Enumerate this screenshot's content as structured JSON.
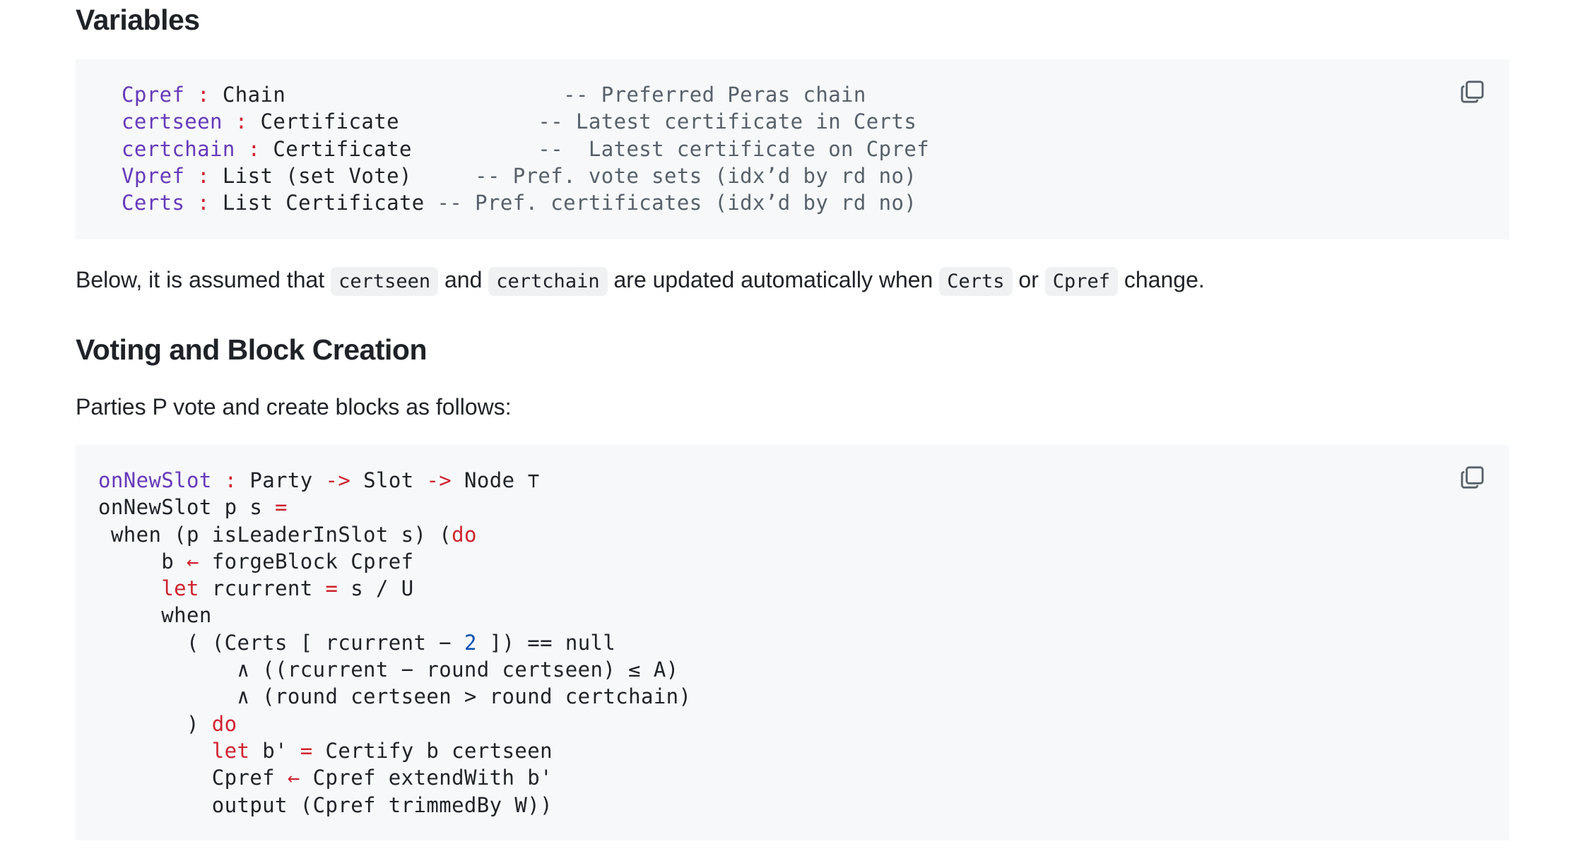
{
  "headings": {
    "variables": "Variables",
    "voting": "Voting and Block Creation"
  },
  "variables_code": {
    "lines": [
      {
        "name": "Cpref",
        "sep": " : ",
        "type": "Chain",
        "pad": "                      ",
        "comment": "-- Preferred Peras chain"
      },
      {
        "name": "certseen",
        "sep": " : ",
        "type": "Certificate",
        "pad": "           ",
        "comment": "-- Latest certificate in Certs"
      },
      {
        "name": "certchain",
        "sep": " : ",
        "type": "Certificate",
        "pad": "          ",
        "comment": "--  Latest certificate on Cpref"
      },
      {
        "name": "Vpref",
        "sep": " : ",
        "type": "List (set Vote)",
        "pad": "     ",
        "comment": "-- Pref. vote sets (idx’d by rd no)"
      },
      {
        "name": "Certs",
        "sep": " : ",
        "type": "List Certificate",
        "pad": " ",
        "comment": "-- Pref. certificates (idx’d by rd no)"
      }
    ]
  },
  "paragraph_assumed": {
    "t1": "Below, it is assumed that ",
    "c1": "certseen",
    "t2": " and ",
    "c2": "certchain",
    "t3": " are updated automatically when ",
    "c3": "Certs",
    "t4": " or ",
    "c4": "Cpref",
    "t5": " change."
  },
  "paragraph_parties": "Parties P vote and create blocks as follows:",
  "voting_code": {
    "l1_fn": "onNewSlot",
    "l1_colon": " : ",
    "l1_a": "Party ",
    "l1_arrow1": "->",
    "l1_b": " Slot ",
    "l1_arrow2": "->",
    "l1_c": " Node ⊤",
    "l2_a": "onNewSlot p s ",
    "l2_eq": "=",
    "l3_a": " when (p isLeaderInSlot s) (",
    "l3_do": "do",
    "l4_a": "     b ",
    "l4_arrow": "←",
    "l4_b": " forgeBlock Cpref",
    "l5_indent": "     ",
    "l5_let": "let",
    "l5_a": " rcurrent ",
    "l5_eq": "=",
    "l5_b": " s / U",
    "l6": "     when",
    "l7_a": "       ( (Certs [ rcurrent − ",
    "l7_num": "2",
    "l7_b": " ]) == null",
    "l8": "           ∧ ((rcurrent − round certseen) ≤ A)",
    "l9": "           ∧ (round certseen > round certchain)",
    "l10_a": "       ) ",
    "l10_do": "do",
    "l11_indent": "         ",
    "l11_let": "let",
    "l11_a": " b' ",
    "l11_eq": "=",
    "l11_b": " Certify b certseen",
    "l12_a": "         Cpref ",
    "l12_arrow": "←",
    "l12_b": " Cpref extendWith b'",
    "l13": "         output (Cpref trimmedBy W))"
  },
  "icons": {
    "copy": "copy-icon"
  },
  "colors": {
    "code_background": "#f6f8fa",
    "identifier_purple": "#6639ba",
    "keyword_red": "#cf222e",
    "number_blue": "#0550ae"
  }
}
